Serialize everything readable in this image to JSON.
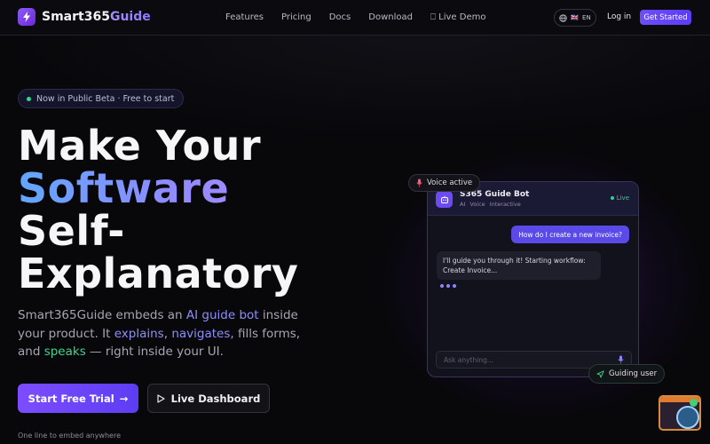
{
  "nav": {
    "brand_prefix": "Smart365",
    "brand_suffix": "Guide",
    "links": [
      "Features",
      "Pricing",
      "Docs",
      "Download"
    ],
    "live_demo_icon": "⎕",
    "live_demo": "Live Demo",
    "lang_flag": "🇬🇧",
    "lang": "EN",
    "login": "Log in",
    "get_started": "Get Started"
  },
  "hero": {
    "badge": "Now in Public Beta · Free to start",
    "headline_line1": "Make Your",
    "headline_line2": "Software",
    "headline_line3": "Self-",
    "headline_line4": "Explanatory",
    "sub_1": "Smart365Guide embeds an ",
    "sub_hl1": "AI guide bot",
    "sub_2": " inside your product. It ",
    "sub_hl2": "explains",
    "sub_3": ", ",
    "sub_hl3": "navigates",
    "sub_4": ", fills forms, and ",
    "sub_hl4": "speaks",
    "sub_5": " — right inside your UI.",
    "cta_primary": "Start Free Trial",
    "cta_primary_icon": "→",
    "cta_secondary": "Live Dashboard",
    "embed_note": "One line to embed anywhere"
  },
  "chat": {
    "bot_name": "S365 Guide Bot",
    "tags": [
      "AI",
      "Voice",
      "Interactive"
    ],
    "status": "Live",
    "user_message": "How do I create a new invoice?",
    "bot_message": "I'll guide you through it! Starting workflow: Create Invoice...",
    "input_placeholder": "Ask anything..."
  },
  "pills": {
    "voice": "Voice active",
    "guiding": "Guiding user"
  },
  "colors": {
    "accent": "#6d4dff",
    "live_green": "#34d08e",
    "background": "#08080b"
  }
}
